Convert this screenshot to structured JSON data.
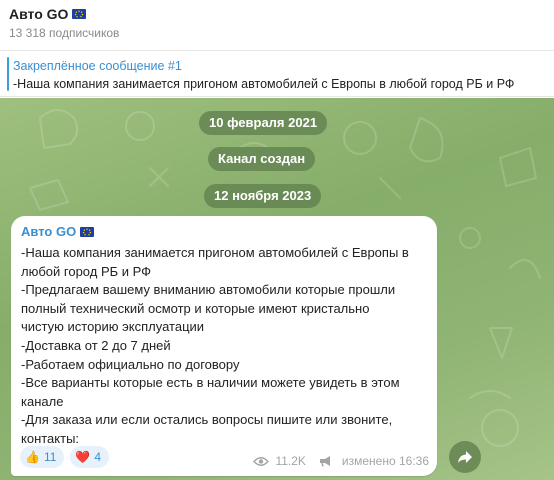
{
  "header": {
    "title": "Авто GO",
    "subscribers": "13 318 подписчиков"
  },
  "pinned": {
    "title": "Закреплённое сообщение #1",
    "text": "-Наша компания занимается пригоном автомобилей с Европы в любой город РБ и РФ"
  },
  "chat": {
    "date_1": "10 февраля 2021",
    "service_message": "Канал создан",
    "date_2": "12 ноября 2023"
  },
  "message": {
    "author": "Авто GO",
    "lines": [
      "-Наша компания занимается пригоном автомобилей с Европы в",
      "любой город РБ и РФ",
      "-Предлагаем вашему вниманию автомобили которые прошли",
      "полный технический осмотр и которые имеют кристально",
      "чистую историю эксплуатации",
      "-Доставка от 2 до 7 дней",
      "-Работаем официально по договору",
      "-Все варианты которые есть в наличии можете увидеть в этом",
      "канале",
      "-Для заказа или если остались вопросы пишите или звоните,",
      "контакты:"
    ],
    "reactions": [
      {
        "emoji": "👍",
        "count": "11"
      },
      {
        "emoji": "❤️",
        "count": "4"
      }
    ],
    "views": "11.2K",
    "edited_time": "изменено 16:36"
  },
  "icons": {
    "flag": "eu-flag-icon",
    "views": "eye-icon",
    "forwarded": "megaphone-icon",
    "share": "share-arrow-icon"
  },
  "colors": {
    "accent": "#3a8fd0",
    "chat_bg": "#8fb474",
    "pill_bg": "#60804e"
  }
}
